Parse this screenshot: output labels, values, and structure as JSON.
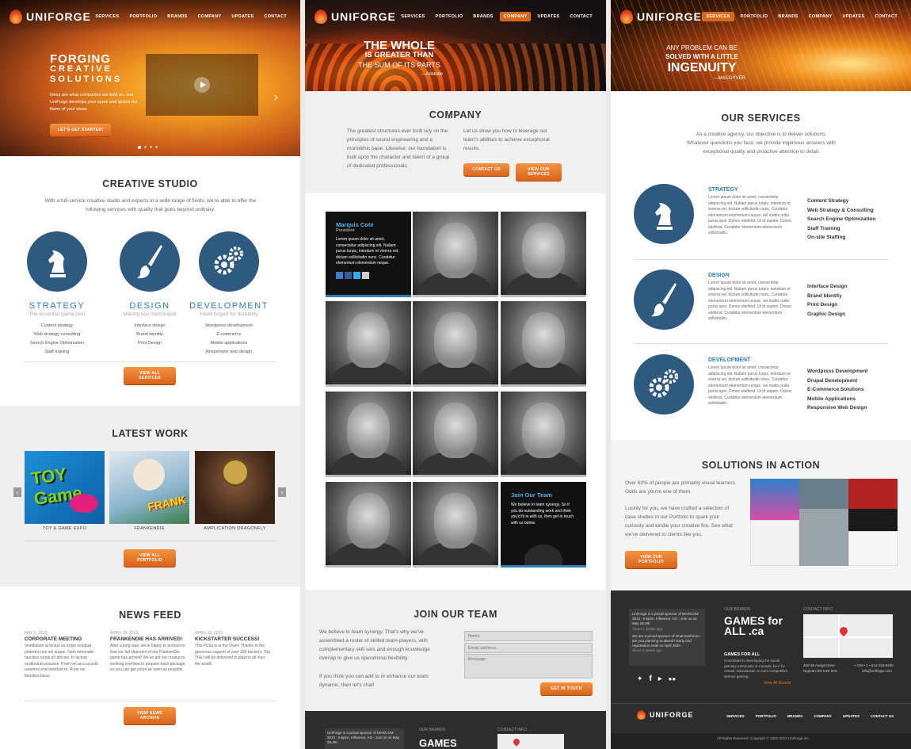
{
  "brand": {
    "name": "UNIFORGE"
  },
  "nav": [
    "SERVICES",
    "PORTFOLIO",
    "BRANDS",
    "COMPANY",
    "UPDATES",
    "CONTACT"
  ],
  "home": {
    "hero_title_1": "FORGING",
    "hero_title_2": "CREATIVE",
    "hero_title_3": "SOLUTIONS",
    "hero_text": "Ideas are what companies are built on, and UniForge develops your spark and ignites the flame of your ideas.",
    "hero_button": "LET'S GET STARTED!",
    "studio_title": "CREATIVE STUDIO",
    "studio_intro": "With a full-service creative studio and experts in a wide range of fields, we're able to offer the following services with quality that goes beyond ordinary:",
    "services": [
      {
        "title": "STRATEGY",
        "subtitle": "The essential game plan",
        "items": [
          "Content strategy",
          "Web strategy consulting",
          "Search Engine Optimization",
          "Staff training"
        ]
      },
      {
        "title": "DESIGN",
        "subtitle": "Making you memorable",
        "items": [
          "Interface design",
          "Brand identity",
          "Print Design"
        ]
      },
      {
        "title": "DEVELOPMENT",
        "subtitle": "Hand forged for durability",
        "items": [
          "Wordpress development",
          "E-commerce",
          "Mobile applications",
          "Responsive web design"
        ]
      }
    ],
    "view_services": "VIEW ALL SERVICES",
    "work_title": "LATEST WORK",
    "works": [
      "TOY & GAME EXPO",
      "FRANKENDIE",
      "AMPLICATION DRAGONFLY"
    ],
    "view_portfolio": "VIEW ALL PORTFOLIO",
    "news_title": "NEWS FEED",
    "news": [
      {
        "date": "MAY 3, 2013",
        "title": "CORPORATE MEETING",
        "text": "Vestibulum at lectus eu turpis volutpat pharetra non vel augue. Nam venenatis faucibus turpis ut ultricies. In lacinia vestibulum posuere. Proin vel arcu a justo euismod erat tincidunt in. Proin vel faucibus lacus."
      },
      {
        "date": "APRIL 15, 2013",
        "title": "FRANKENDIE HAS ARRIVED!",
        "text": "After a long wait, we're happy to announce that our full shipment of our FrankenDie game has arrived! We've got our creatures working overtime to prepare each package so you can get yours as soon as possible."
      },
      {
        "date": "APRIL 15, 2013",
        "title": "KICKSTARTER SUCCESS!",
        "text": "This Pizza is in the Oven! Thanks to the generous support of over 330 backers, Top This! will be delivered to players all over the world!"
      }
    ],
    "view_news": "VIEW NEWS ARCHIVE"
  },
  "company": {
    "hero_line_1": "THE WHOLE",
    "hero_line_2": "IS GREATER THAN",
    "hero_line_3": "THE SUM OF ITS PARTS",
    "hero_author": "—Aristotle",
    "title": "COMPANY",
    "text_left": "The greatest structures ever built rely on the principles of sound engineering and a monolithic base. Likewise, our foundation is built upon the character and talent of a group of dedicated professionals.",
    "text_right": "Let us show you how to leverage our team's abilities to achieve exceptional results.",
    "contact_button": "CONTACT US",
    "services_button": "VIEW OUR SERVICES",
    "member_name": "Marquis Cote",
    "member_role": "President",
    "member_bio": "Lorem ipsum dolor sit amet, consectetur adipiscing elit. Nullam purus turpis, interdum et viverra vel, dictum sollicitudin nunc. Curabitur elementum elementum neque.",
    "join_card_title": "Join Our Team",
    "join_card_text": "We believe in team synergy. So if you do outstanding work and think you'd fit in with us, then get in touch with us below.",
    "join_title": "JOIN OUR TEAM",
    "join_text_1": "We believe in team synergy. That's why we've assembled a roster of skilled team-players, with complementary skill sets and enough knowledge overlap to give us operational flexibility.",
    "join_text_2": "If you think you can add to or enhance our team dynamic, then let's chat!",
    "field_name": "Name",
    "field_email": "Email address",
    "field_message": "Message",
    "touch_button": "GET IN TOUCH",
    "footer_tweet": "UniForge is a proud sponsor of MARCOM 2013 - Inspire, Influence, Act - Join us on May 28-29!",
    "footer_brands": "OUR BRANDS",
    "footer_contact": "CONTACT INFO",
    "footer_games": "GAMES"
  },
  "services_page": {
    "hero_line_1": "ANY PROBLEM CAN BE",
    "hero_line_2": "SOLVED WITH A LITTLE",
    "hero_line_3": "INGENUITY",
    "hero_author": "—MACGYVER",
    "title": "OUR SERVICES",
    "intro": "As a creative agency, our objective is to deliver solutions. Whatever questions you face, we provide ingenious answers with exceptional quality and proactive attention to detail.",
    "lorem": "Lorem ipsum dolor sit amet, consectetur adipiscing elit. Nullam purus turpis, interdum et viverra vel, dictum sollicitudin nunc. Curabitur elementum elementum neque, vel mattis nulla purus quis. Donec eleifend. Ut id sapien. Donec eleifend. Curabitur elementum elementum sollicitudin.",
    "services": [
      {
        "title": "STRATEGY",
        "items": [
          "Content Strategy",
          "Web Strategy & Consulting",
          "Search Engine Optimization",
          "Staff Training",
          "On-site Staffing"
        ]
      },
      {
        "title": "DESIGN",
        "items": [
          "Interface Design",
          "Brand Identity",
          "Print Design",
          "Graphic Design"
        ]
      },
      {
        "title": "DEVELOPMENT",
        "items": [
          "Wordpress Development",
          "Drupal Development",
          "E-Commerce Solutions",
          "Mobile Applications",
          "Responsive Web Design"
        ]
      }
    ],
    "solutions_title": "SOLUTIONS IN ACTION",
    "solutions_text_1": "Over 60% of people are primarily visual learners. Odds are you're one of them.",
    "solutions_text_2": "Luckily for you, we have crafted a selection of case studies in our Portfolio to spark your curiosity and kindle your creative fire. See what we've delivered to clients like you.",
    "portfolio_button": "VIEW OUR PORTFOLIO",
    "footer_tweet_1": "UniForge is a proud sponsor of MARCOM 2013 - Inspire, Influence, Act - Join us on May 28-29!",
    "footer_tweet_1_time": "About 1 weeks ago",
    "footer_tweet_2": "We are a proud sponsor of #marcomforum - are you planning to attend? Early bird registration ends on April 15th!",
    "footer_tweet_2_time": "about 3 weeks ago",
    "footer_brands": "OUR BRANDS",
    "footer_contact": "CONTACT INFO",
    "games_logo": "GAMES for ALL .ca",
    "games_title": "GAMES FOR ALL",
    "games_text": "Committed to developing the social gaming community in Canada, be it for casual, educational, or even competitive serious gaming.",
    "view_brands": "View All Brands",
    "address": "300-36 Auriga Drive Nepean ON K2E 8A5",
    "phone": "+ OM • 1 • 613-233-8400",
    "email": "info@uniforge.com",
    "footer_nav": [
      "SERVICES",
      "PORTFOLIO",
      "BRANDS",
      "COMPANY",
      "UPDATES",
      "CONTACT US"
    ],
    "copyright": "All Rights Reserved. Copyright © 2004-2013 UniForge Inc."
  },
  "colors": {
    "accent": "#e8731e",
    "brand_blue": "#2e5a7f",
    "footer": "#2d2d2d"
  }
}
